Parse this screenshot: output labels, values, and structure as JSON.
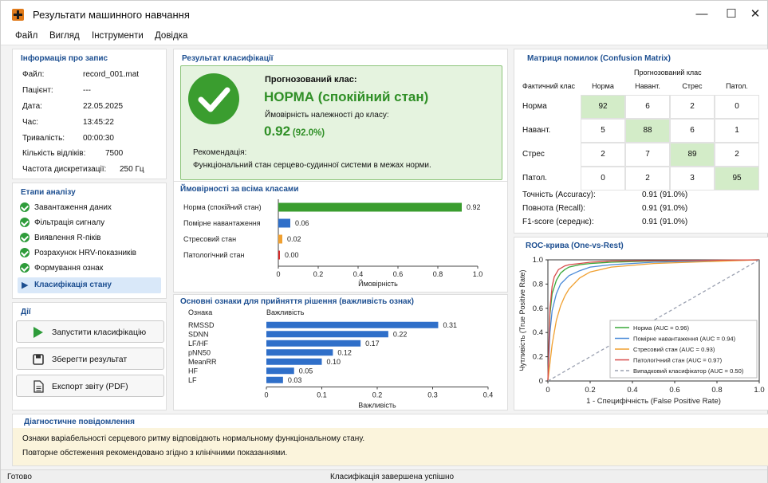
{
  "window": {
    "title": "Результати машинного навчання",
    "minimize": "—",
    "maximize": "☐",
    "close": "✕"
  },
  "menu": [
    "Файл",
    "Вигляд",
    "Інструменти",
    "Довідка"
  ],
  "record": {
    "title": "Інформація про запис",
    "rows": [
      {
        "label": "Файл:",
        "value": "record_001.mat"
      },
      {
        "label": "Пацієнт:",
        "value": "---"
      },
      {
        "label": "Дата:",
        "value": "22.05.2025"
      },
      {
        "label": "Час:",
        "value": "13:45:22"
      },
      {
        "label": "Тривалість:",
        "value": "00:00:30"
      },
      {
        "label": "Кількість відліків:",
        "value": "7500"
      },
      {
        "label": "Частота дискретизації:",
        "value": "250 Гц"
      }
    ]
  },
  "stages": {
    "title": "Етапи аналізу",
    "items": [
      "Завантаження даних",
      "Фільтрація сигналу",
      "Виявлення R-піків",
      "Розрахунок HRV-показників",
      "Формування ознак"
    ],
    "active": "Класифікація стану"
  },
  "actions": {
    "title": "Дії",
    "run": "Запустити класифікацію",
    "save": "Зберегти результат",
    "export": "Експорт звіту (PDF)"
  },
  "result": {
    "title": "Результат класифікації",
    "predicted_label": "Прогнозований клас:",
    "predicted_value": "НОРМА (спокійний стан)",
    "prob_label": "Ймовірність належності до класу:",
    "prob_value": "0.92",
    "prob_pct": "(92.0%)",
    "rec_label": "Рекомендація:",
    "rec_text": "Функціональний стан серцево-судинної системи в межах норми."
  },
  "confusion": {
    "title": "Матриця помилок (Confusion Matrix)",
    "predicted_header": "Прогнозований клас",
    "actual_header": "Фактичний клас",
    "cols": [
      "Норма",
      "Навант.",
      "Стрес",
      "Патол."
    ],
    "rows": [
      {
        "label": "Норма",
        "values": [
          92,
          6,
          2,
          0
        ]
      },
      {
        "label": "Навант.",
        "values": [
          5,
          88,
          6,
          1
        ]
      },
      {
        "label": "Стрес",
        "values": [
          2,
          7,
          89,
          2
        ]
      },
      {
        "label": "Патол.",
        "values": [
          0,
          2,
          3,
          95
        ]
      }
    ],
    "metrics": [
      {
        "label": "Точність (Accuracy):",
        "value": "0.91 (91.0%)"
      },
      {
        "label": "Повнота (Recall):",
        "value": "0.91 (91.0%)"
      },
      {
        "label": "F1-score (середнє):",
        "value": "0.91 (91.0%)"
      }
    ]
  },
  "chart_data": [
    {
      "id": "probs",
      "type": "bar",
      "orientation": "horizontal",
      "title": "Ймовірності за всіма класами",
      "categories": [
        "Норма (спокійний стан)",
        "Помірне навантаження",
        "Стресовий стан",
        "Патологічний стан"
      ],
      "values": [
        0.92,
        0.06,
        0.02,
        0.0
      ],
      "value_labels": [
        "0.92",
        "0.06",
        "0.02",
        "0.00"
      ],
      "colors": [
        "#3a9d2f",
        "#2f6fc9",
        "#f0a030",
        "#d62b2b"
      ],
      "xlabel": "Ймовірність",
      "xlim": [
        0,
        1
      ],
      "xticks": [
        "0",
        "0.2",
        "0.4",
        "0.6",
        "0.8",
        "1.0"
      ]
    },
    {
      "id": "features",
      "type": "bar",
      "orientation": "horizontal",
      "title": "Основні ознаки для прийняття рішення (важливість ознак)",
      "col_feature": "Ознака",
      "col_importance": "Важливість",
      "categories": [
        "RMSSD",
        "SDNN",
        "LF/HF",
        "pNN50",
        "MeanRR",
        "HF",
        "LF"
      ],
      "values": [
        0.31,
        0.22,
        0.17,
        0.12,
        0.1,
        0.05,
        0.03
      ],
      "value_labels": [
        "0.31",
        "0.22",
        "0.17",
        "0.12",
        "0.10",
        "0.05",
        "0.03"
      ],
      "color": "#2f6fc9",
      "xlabel": "Важливість",
      "xlim": [
        0,
        0.4
      ],
      "xticks": [
        "0",
        "0.1",
        "0.2",
        "0.3",
        "0.4"
      ]
    },
    {
      "id": "roc",
      "type": "line",
      "title": "ROC-крива (One-vs-Rest)",
      "xlabel": "1 - Специфічність (False Positive Rate)",
      "ylabel": "Чутливість (True Positive Rate)",
      "xlim": [
        0,
        1
      ],
      "ylim": [
        0,
        1
      ],
      "xticks": [
        "0",
        "0.2",
        "0.4",
        "0.6",
        "0.8",
        "1.0"
      ],
      "yticks": [
        "0",
        "0.2",
        "0.4",
        "0.6",
        "0.8",
        "1.0"
      ],
      "legend_position": "lower-right",
      "series": [
        {
          "name": "Норма (AUC = 0.96)",
          "color": "#3aa83a",
          "x": [
            0,
            0.01,
            0.02,
            0.04,
            0.06,
            0.08,
            0.1,
            0.15,
            0.2,
            0.3,
            0.5,
            1
          ],
          "y": [
            0,
            0.55,
            0.72,
            0.83,
            0.89,
            0.92,
            0.94,
            0.96,
            0.97,
            0.98,
            0.99,
            1
          ]
        },
        {
          "name": "Помірне навантаження (AUC = 0.94)",
          "color": "#4a8ad8",
          "x": [
            0,
            0.01,
            0.02,
            0.04,
            0.06,
            0.1,
            0.15,
            0.2,
            0.3,
            0.5,
            1
          ],
          "y": [
            0,
            0.4,
            0.58,
            0.72,
            0.8,
            0.87,
            0.91,
            0.94,
            0.96,
            0.98,
            1
          ]
        },
        {
          "name": "Стресовий стан (AUC = 0.93)",
          "color": "#f0a030",
          "x": [
            0,
            0.02,
            0.04,
            0.06,
            0.08,
            0.1,
            0.15,
            0.2,
            0.3,
            0.5,
            1
          ],
          "y": [
            0,
            0.3,
            0.5,
            0.62,
            0.7,
            0.76,
            0.85,
            0.9,
            0.94,
            0.97,
            1
          ]
        },
        {
          "name": "Патологічний стан (AUC = 0.97)",
          "color": "#d84a4a",
          "x": [
            0,
            0.01,
            0.02,
            0.03,
            0.05,
            0.08,
            0.1,
            0.15,
            0.2,
            0.3,
            1
          ],
          "y": [
            0,
            0.6,
            0.78,
            0.86,
            0.92,
            0.95,
            0.96,
            0.97,
            0.98,
            0.99,
            1
          ]
        },
        {
          "name": "Випадковий класифікатор (AUC = 0.50)",
          "color": "#9aa0b0",
          "dashed": true,
          "x": [
            0,
            1
          ],
          "y": [
            0,
            1
          ]
        }
      ]
    }
  ],
  "diagnostic": {
    "title": "Діагностичне повідомлення",
    "line1": "Ознаки варіабельності серцевого ритму відповідають нормальному функціональному стану.",
    "line2": "Повторне обстеження рекомендовано згідно з клінічними показаннями."
  },
  "status": {
    "left": "Готово",
    "center": "Класифікація завершена успішно"
  }
}
